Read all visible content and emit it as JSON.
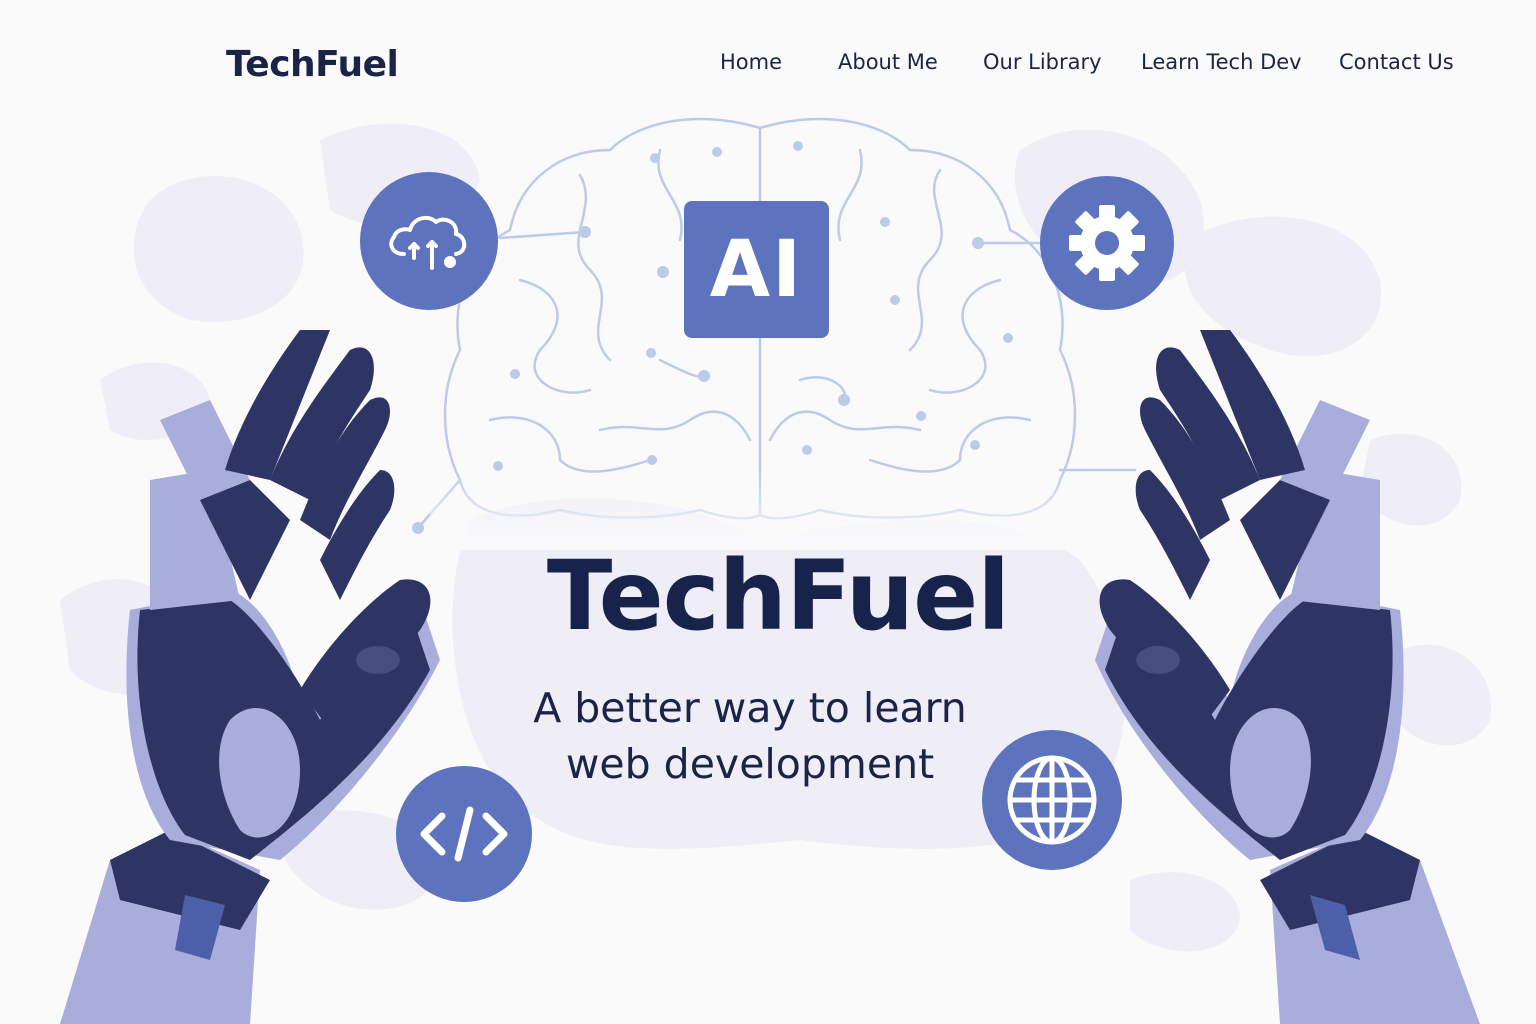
{
  "header": {
    "logo": "TechFuel",
    "nav": [
      {
        "label": "Home"
      },
      {
        "label": "About Me"
      },
      {
        "label": "Our Library"
      },
      {
        "label": "Learn Tech Dev"
      },
      {
        "label": "Contact Us"
      }
    ]
  },
  "hero": {
    "badge": "AI",
    "title": "TechFuel",
    "subtitle_line1": "A better way to learn",
    "subtitle_line2": "web development"
  },
  "icons": [
    "cloud-network-icon",
    "gear-icon",
    "code-icon",
    "globe-icon",
    "brain-circuit-illustration",
    "robot-hand-left",
    "robot-hand-right"
  ],
  "colors": {
    "background": "#fbfafb",
    "accent": "#5d73bd",
    "navy": "#1b2347",
    "robot_dark": "#2e3463",
    "robot_light": "#a9addb",
    "brain_line": "#b7c8e8",
    "blob": "#eeecf6"
  }
}
